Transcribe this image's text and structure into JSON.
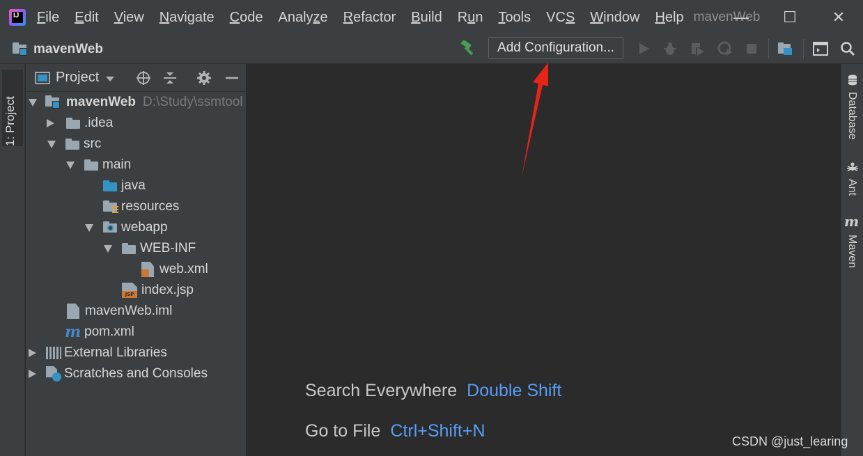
{
  "window": {
    "project_title": "mavenWeb",
    "menu": [
      {
        "pre": "",
        "u": "F",
        "post": "ile"
      },
      {
        "pre": "",
        "u": "E",
        "post": "dit"
      },
      {
        "pre": "",
        "u": "V",
        "post": "iew"
      },
      {
        "pre": "",
        "u": "N",
        "post": "avigate"
      },
      {
        "pre": "",
        "u": "C",
        "post": "ode"
      },
      {
        "pre": "Analy",
        "u": "z",
        "post": "e"
      },
      {
        "pre": "",
        "u": "R",
        "post": "efactor"
      },
      {
        "pre": "",
        "u": "B",
        "post": "uild"
      },
      {
        "pre": "R",
        "u": "u",
        "post": "n"
      },
      {
        "pre": "",
        "u": "T",
        "post": "ools"
      },
      {
        "pre": "VC",
        "u": "S",
        "post": ""
      },
      {
        "pre": "",
        "u": "W",
        "post": "indow"
      },
      {
        "pre": "",
        "u": "H",
        "post": "elp"
      }
    ],
    "controls": {
      "minimize": "—",
      "maximize": "☐",
      "close": "✕"
    }
  },
  "navbar": {
    "project_name": "mavenWeb",
    "add_configuration": "Add Configuration..."
  },
  "left_strip": {
    "tab_label": "1: Project"
  },
  "project_panel": {
    "title": "Project",
    "tree": [
      {
        "label": "mavenWeb",
        "path": "D:\\Study\\ssmtool",
        "bold": true
      },
      {
        "label": ".idea"
      },
      {
        "label": "src"
      },
      {
        "label": "main"
      },
      {
        "label": "java"
      },
      {
        "label": "resources"
      },
      {
        "label": "webapp"
      },
      {
        "label": "WEB-INF"
      },
      {
        "label": "web.xml"
      },
      {
        "label": "index.jsp"
      },
      {
        "label": "mavenWeb.iml"
      },
      {
        "label": "pom.xml"
      },
      {
        "label": "External Libraries"
      },
      {
        "label": "Scratches and Consoles"
      }
    ]
  },
  "editor": {
    "hints": [
      {
        "action": "Search Everywhere",
        "shortcut": "Double Shift"
      },
      {
        "action": "Go to File",
        "shortcut": "Ctrl+Shift+N"
      }
    ]
  },
  "right_strip": {
    "tabs": [
      {
        "label": "Database",
        "icon": "database-icon"
      },
      {
        "label": "Ant",
        "icon": "ant-icon"
      },
      {
        "label": "Maven",
        "icon": "maven-icon"
      }
    ]
  },
  "watermark": "CSDN @just_learing",
  "colors": {
    "accent": "#589df6",
    "annotation_arrow": "#e8231a",
    "folder_blue": "#3592c4"
  }
}
